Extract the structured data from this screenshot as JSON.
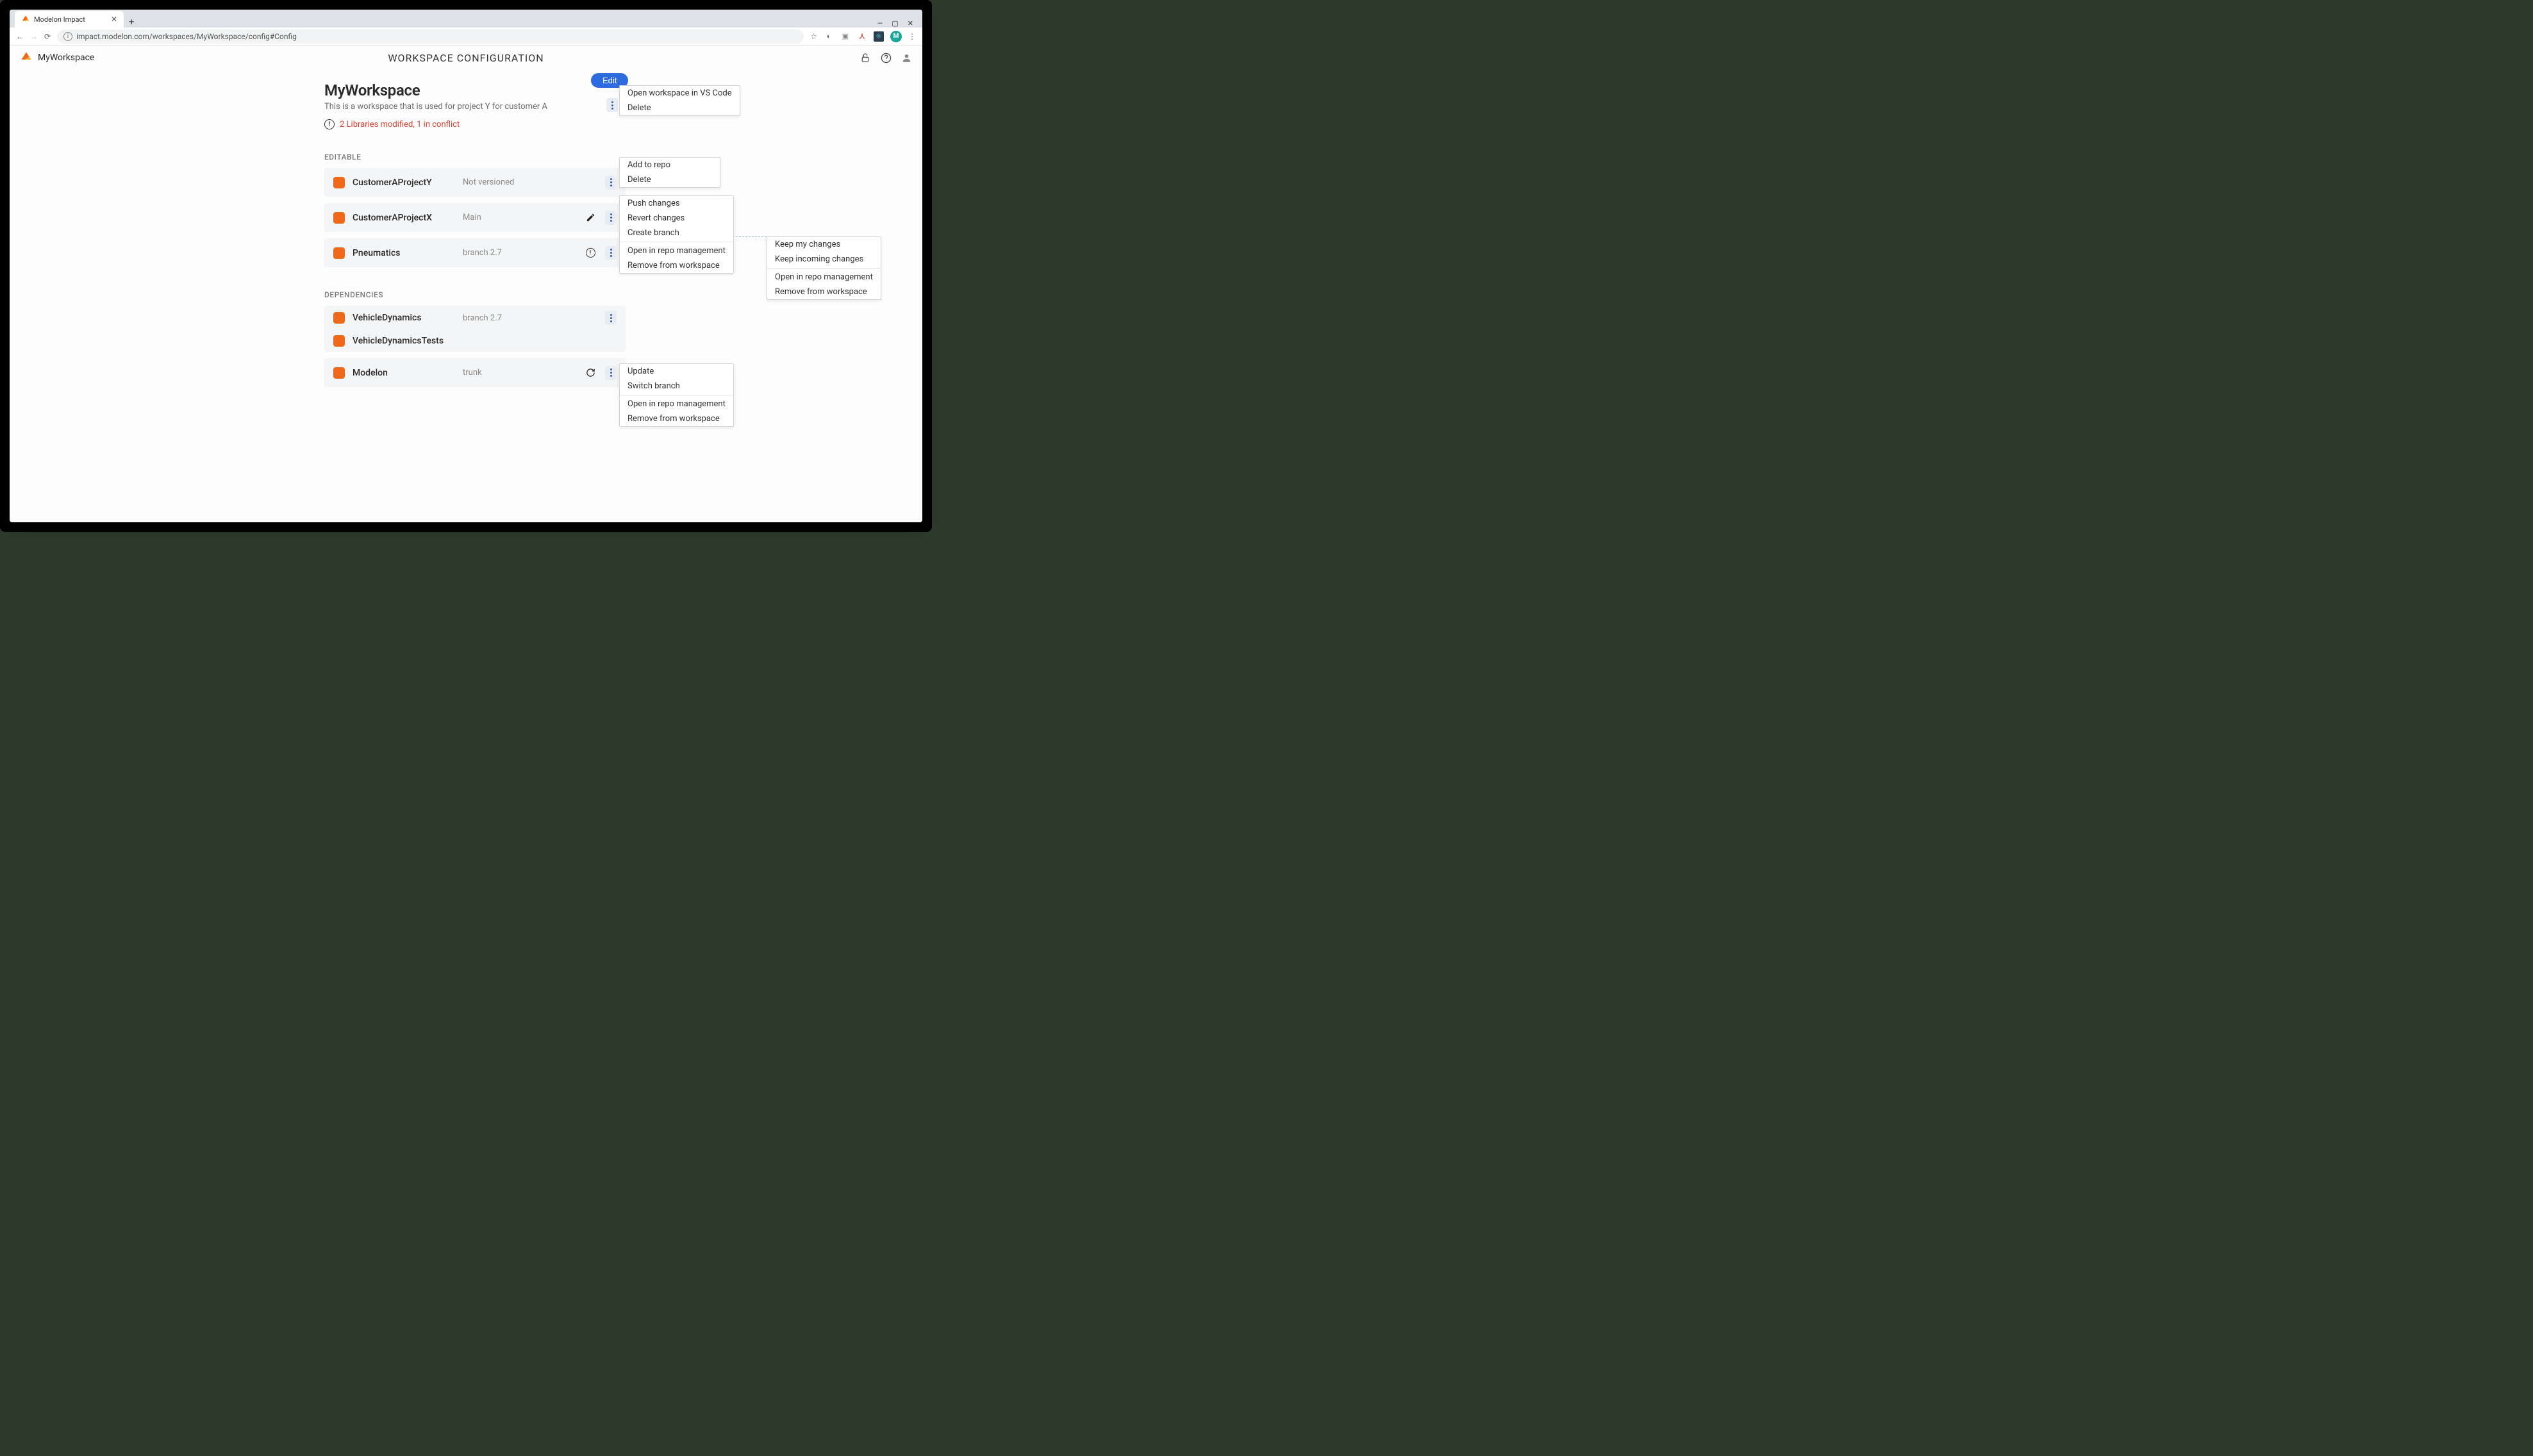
{
  "browser": {
    "tab_title": "Modelon Impact",
    "url_display": "impact.modelon.com/workspaces/MyWorkspace/config#Config",
    "avatar_letter": "M"
  },
  "header": {
    "workspace_name": "MyWorkspace",
    "page_title": "WORKSPACE CONFIGURATION"
  },
  "workspace": {
    "title": "MyWorkspace",
    "description": "This is a workspace that is used for project Y for customer A",
    "alert": "2 Libraries modified, 1 in conflict",
    "edit_label": "Edit"
  },
  "sections": {
    "editable_label": "EDITABLE",
    "dependencies_label": "DEPENDENCIES"
  },
  "editable": [
    {
      "name": "CustomerAProjectY",
      "branch": "Not versioned"
    },
    {
      "name": "CustomerAProjectX",
      "branch": "Main"
    },
    {
      "name": "Pneumatics",
      "branch": "branch 2.7"
    }
  ],
  "dependencies": [
    {
      "name": "VehicleDynamics",
      "branch": "branch 2.7"
    },
    {
      "name": "VehicleDynamicsTests",
      "branch": ""
    },
    {
      "name": "Modelon",
      "branch": "trunk"
    }
  ],
  "menus": {
    "workspace": [
      "Open workspace in VS Code",
      "Delete"
    ],
    "not_versioned": [
      "Add to repo",
      "Delete"
    ],
    "versioned_editable": {
      "top": [
        "Push changes",
        "Revert changes",
        "Create branch"
      ],
      "bottom": [
        "Open in repo management",
        "Remove from workspace"
      ]
    },
    "conflict": {
      "top": [
        "Keep my changes",
        "Keep incoming changes"
      ],
      "bottom": [
        "Open in repo management",
        "Remove from workspace"
      ]
    },
    "dependency": {
      "top": [
        "Update",
        "Switch branch"
      ],
      "bottom": [
        "Open in repo management",
        "Remove from workspace"
      ]
    }
  }
}
